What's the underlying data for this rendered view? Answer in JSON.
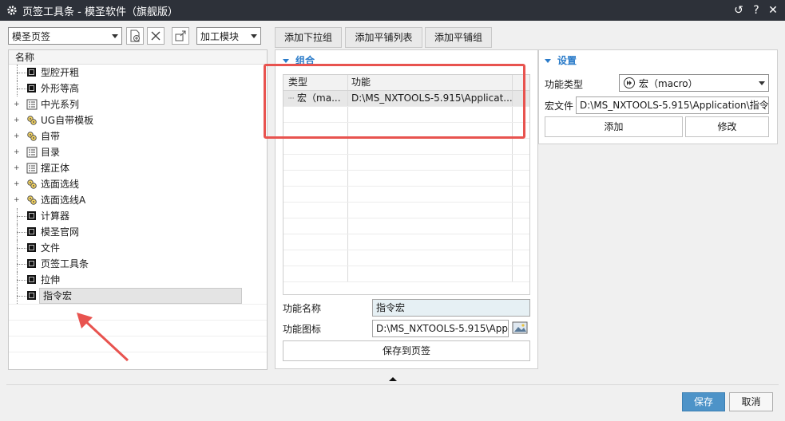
{
  "window": {
    "title": "页签工具条 - 模圣软件（旗舰版）",
    "controls": [
      "↺",
      "?",
      "✕"
    ]
  },
  "left": {
    "tab_combo_value": "模圣页签",
    "module_combo_value": "加工模块",
    "tree_header": "名称",
    "items": [
      {
        "label": "型腔开粗",
        "icon": "black-square-icon",
        "expandable": false
      },
      {
        "label": "外形等高",
        "icon": "black-square-icon",
        "expandable": false
      },
      {
        "label": "中光系列",
        "icon": "list-icon",
        "expandable": true
      },
      {
        "label": "UG自带模板",
        "icon": "gear-group-icon",
        "expandable": true
      },
      {
        "label": "自带",
        "icon": "gear-group-icon",
        "expandable": true
      },
      {
        "label": "目录",
        "icon": "list-icon",
        "expandable": true
      },
      {
        "label": "摆正体",
        "icon": "list-icon",
        "expandable": true
      },
      {
        "label": "选面选线",
        "icon": "gear-group-icon",
        "expandable": true
      },
      {
        "label": "选面选线A",
        "icon": "gear-group-icon",
        "expandable": true
      },
      {
        "label": "计算器",
        "icon": "black-square-icon",
        "expandable": false
      },
      {
        "label": "模圣官网",
        "icon": "black-square-icon",
        "expandable": false
      },
      {
        "label": "文件",
        "icon": "black-square-icon",
        "expandable": false
      },
      {
        "label": "页签工具条",
        "icon": "black-square-icon",
        "expandable": false
      },
      {
        "label": "拉伸",
        "icon": "black-square-icon",
        "expandable": false
      },
      {
        "label": "指令宏",
        "icon": "black-square-icon",
        "expandable": false,
        "selected": true
      }
    ]
  },
  "center": {
    "tabs": [
      "添加下拉组",
      "添加平铺列表",
      "添加平铺组"
    ],
    "group_title": "组合",
    "grid_headers": [
      "类型",
      "功能"
    ],
    "grid_rows": [
      {
        "type": "宏（ma...",
        "func": "D:\\MS_NXTOOLS-5.915\\Applicat..."
      }
    ],
    "func_name_label": "功能名称",
    "func_name_value": "指令宏",
    "func_icon_label": "功能图标",
    "func_icon_value": "D:\\MS_NXTOOLS-5.915\\App",
    "save_button": "保存到页签"
  },
  "settings": {
    "title": "设置",
    "func_type_label": "功能类型",
    "func_type_value": "宏（macro）",
    "macro_file_label": "宏文件",
    "macro_file_value": "D:\\MS_NXTOOLS-5.915\\Application\\指令",
    "add_button": "添加",
    "modify_button": "修改"
  },
  "footer": {
    "save": "保存",
    "cancel": "取消"
  },
  "colors": {
    "titlebar": "#2d3139",
    "accent": "#2a7bc9",
    "primary_button": "#4d93c8",
    "annotation_red": "#e8534f"
  }
}
